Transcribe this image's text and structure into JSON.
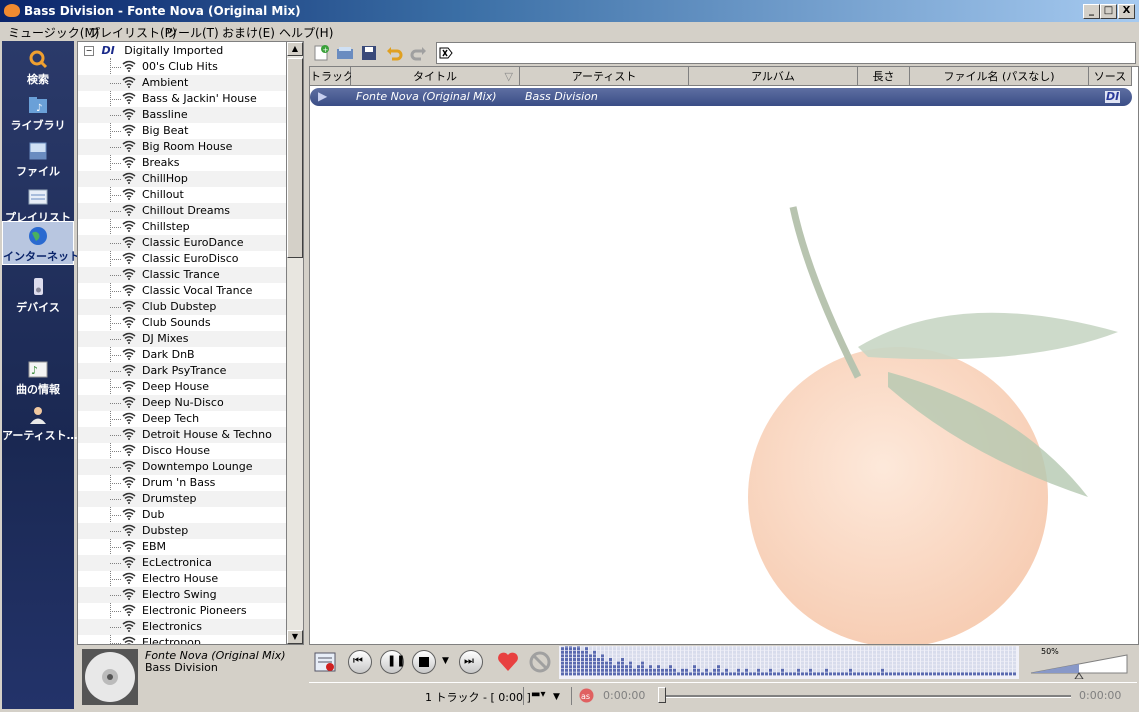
{
  "window": {
    "title": "Bass Division - Fonte Nova (Original Mix)",
    "min_label": "_",
    "max_label": "□",
    "close_label": "X"
  },
  "menu": [
    {
      "label": "ミュージック(M)"
    },
    {
      "label": "プレイリスト(P)"
    },
    {
      "label": "ツール(T)"
    },
    {
      "label": "おまけ(E)"
    },
    {
      "label": "ヘルプ(H)"
    }
  ],
  "nav": [
    {
      "label": "検索",
      "icon": "search-icon"
    },
    {
      "label": "ライブラリ",
      "icon": "library-icon"
    },
    {
      "label": "ファイル",
      "icon": "file-icon"
    },
    {
      "label": "プレイリスト",
      "icon": "playlist-icon"
    },
    {
      "label": "インターネット",
      "icon": "internet-icon"
    },
    {
      "label": "デバイス",
      "icon": "device-icon"
    },
    {
      "label": "曲の情報",
      "icon": "song-info-icon"
    },
    {
      "label": "アーティスト…",
      "icon": "artist-icon"
    }
  ],
  "tree": {
    "root": "Digitally Imported",
    "root_badge": "DI",
    "items": [
      "00's Club Hits",
      "Ambient",
      "Bass & Jackin' House",
      "Bassline",
      "Big Beat",
      "Big Room House",
      "Breaks",
      "ChillHop",
      "Chillout",
      "Chillout Dreams",
      "Chillstep",
      "Classic EuroDance",
      "Classic EuroDisco",
      "Classic Trance",
      "Classic Vocal Trance",
      "Club Dubstep",
      "Club Sounds",
      "DJ Mixes",
      "Dark DnB",
      "Dark PsyTrance",
      "Deep House",
      "Deep Nu-Disco",
      "Deep Tech",
      "Detroit House & Techno",
      "Disco House",
      "Downtempo Lounge",
      "Drum 'n Bass",
      "Drumstep",
      "Dub",
      "Dubstep",
      "EBM",
      "EcLectronica",
      "Electro House",
      "Electro Swing",
      "Electronic Pioneers",
      "Electronics",
      "Electropop"
    ]
  },
  "columns": [
    "トラック",
    "タイトル",
    "アーティスト",
    "アルバム",
    "長さ",
    "ファイル名 (パスなし)",
    "ソース"
  ],
  "tracks": [
    {
      "title": "Fonte Nova (Original Mix)",
      "artist": "Bass Division",
      "source": "DI"
    }
  ],
  "now_playing": {
    "title": "Fonte Nova (Original Mix)",
    "artist": "Bass Division"
  },
  "volume": {
    "label": "50%",
    "value": 0.5
  },
  "status": {
    "track_count": "1 トラック - [ 0:00 ]",
    "elapsed": "0:00:00",
    "remaining": "0:00:00"
  }
}
